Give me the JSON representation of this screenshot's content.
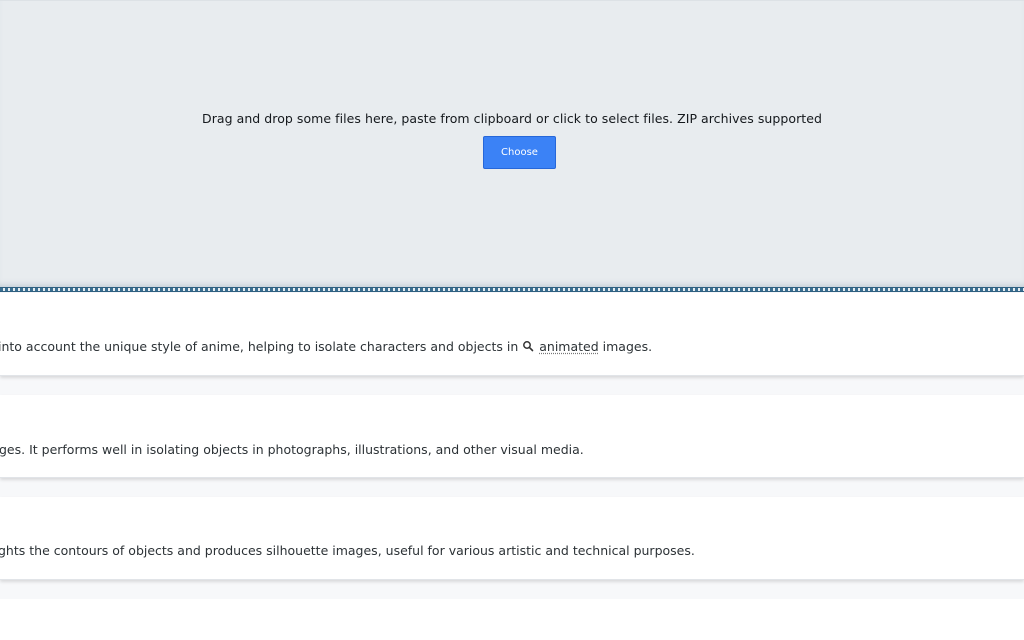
{
  "upload": {
    "instruction": "Drag and drop some files here, paste from clipboard or click to select files. ZIP archives supported",
    "choose_label": "Choose"
  },
  "colors": {
    "accent": "#3b82f6",
    "dropzone_bg": "#e8ecef",
    "border": "#3a6f91"
  },
  "cards": [
    {
      "text_before": "into account the unique style of anime, helping to isolate characters and objects in",
      "link_text": "animated",
      "link_icon": "search-icon",
      "text_after": " images."
    },
    {
      "text": "ges. It performs well in isolating objects in photographs, illustrations, and other visual media."
    },
    {
      "text": "ghts the contours of objects and produces silhouette images, useful for various artistic and technical purposes."
    }
  ]
}
